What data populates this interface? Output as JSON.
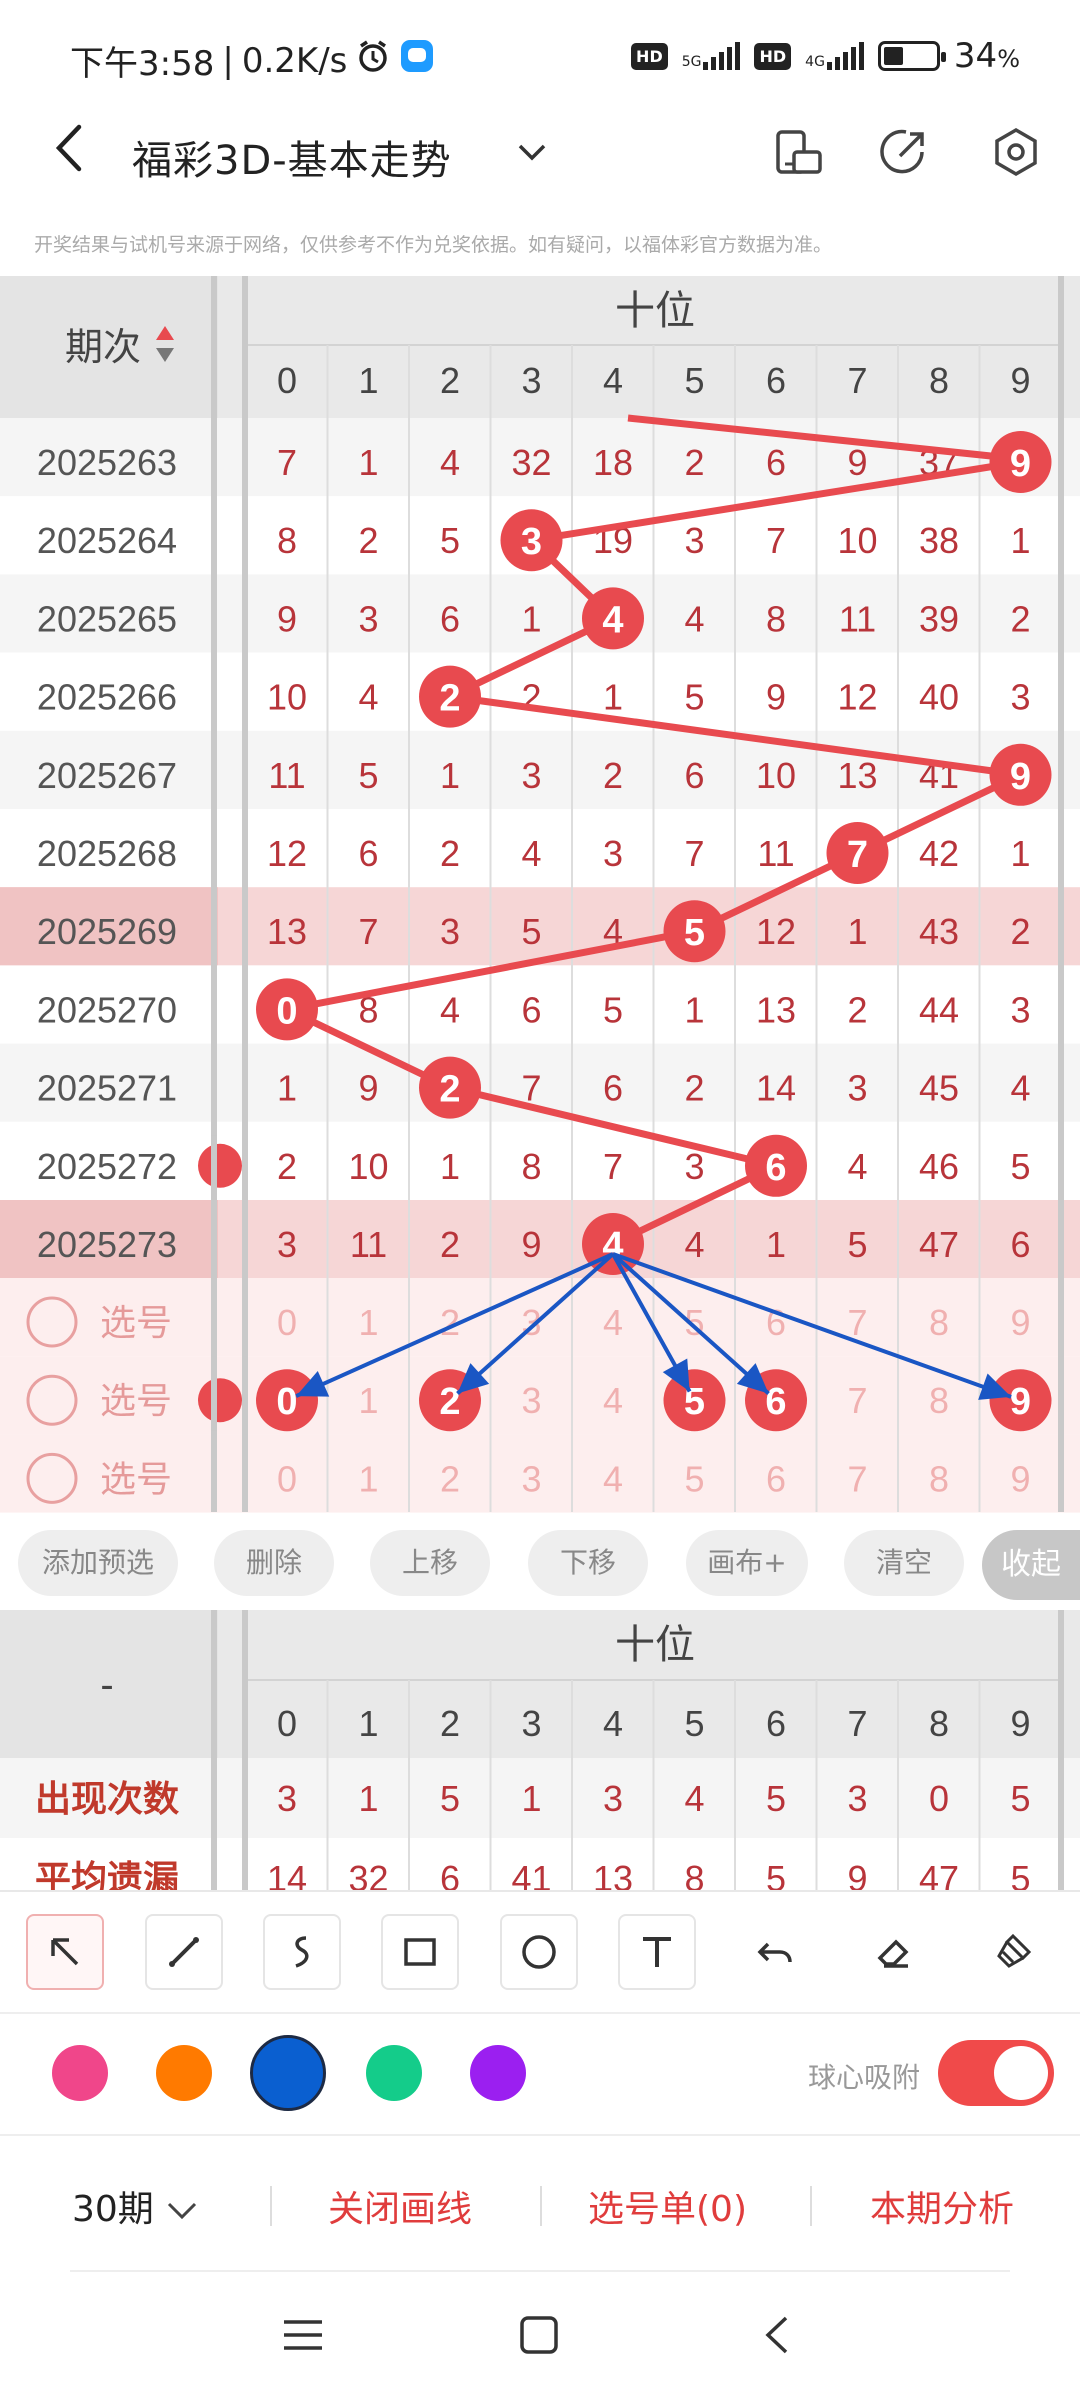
{
  "status_bar": {
    "time": "下午3:58",
    "speed": "0.2K/s",
    "net1": "5G",
    "net2": "4G",
    "hd": "HD",
    "battery": "34",
    "battery_unit": "%"
  },
  "header": {
    "title": "福彩3D-基本走势"
  },
  "disclaimer": "开奖结果与试机号来源于网络，仅供参考不作为兑奖依据。如有疑问，以福体彩官方数据为准。",
  "table": {
    "period_header": "期次",
    "position_header": "十位",
    "digits": [
      "0",
      "1",
      "2",
      "3",
      "4",
      "5",
      "6",
      "7",
      "8",
      "9"
    ],
    "rows": [
      {
        "period": "2025263",
        "cells": [
          "7",
          "1",
          "4",
          "32",
          "18",
          "2",
          "6",
          "9",
          "37",
          "9"
        ],
        "hit": 9
      },
      {
        "period": "2025264",
        "cells": [
          "8",
          "2",
          "5",
          "3",
          "19",
          "3",
          "7",
          "10",
          "38",
          "1"
        ],
        "hit": 3
      },
      {
        "period": "2025265",
        "cells": [
          "9",
          "3",
          "6",
          "1",
          "4",
          "4",
          "8",
          "11",
          "39",
          "2"
        ],
        "hit": 4
      },
      {
        "period": "2025266",
        "cells": [
          "10",
          "4",
          "2",
          "2",
          "1",
          "5",
          "9",
          "12",
          "40",
          "3"
        ],
        "hit": 2
      },
      {
        "period": "2025267",
        "cells": [
          "11",
          "5",
          "1",
          "3",
          "2",
          "6",
          "10",
          "13",
          "41",
          "9"
        ],
        "hit": 9
      },
      {
        "period": "2025268",
        "cells": [
          "12",
          "6",
          "2",
          "4",
          "3",
          "7",
          "11",
          "7",
          "42",
          "1"
        ],
        "hit": 7
      },
      {
        "period": "2025269",
        "cells": [
          "13",
          "7",
          "3",
          "5",
          "4",
          "5",
          "12",
          "1",
          "43",
          "2"
        ],
        "hit": 5
      },
      {
        "period": "2025270",
        "cells": [
          "0",
          "8",
          "4",
          "6",
          "5",
          "1",
          "13",
          "2",
          "44",
          "3"
        ],
        "hit": 0
      },
      {
        "period": "2025271",
        "cells": [
          "1",
          "9",
          "2",
          "7",
          "6",
          "2",
          "14",
          "3",
          "45",
          "4"
        ],
        "hit": 2
      },
      {
        "period": "2025272",
        "cells": [
          "2",
          "10",
          "1",
          "8",
          "7",
          "3",
          "6",
          "4",
          "46",
          "5"
        ],
        "hit": 6
      },
      {
        "period": "2025273",
        "cells": [
          "3",
          "11",
          "2",
          "9",
          "4",
          "4",
          "1",
          "5",
          "47",
          "6"
        ],
        "hit": 4
      }
    ],
    "select_label": "选号",
    "select_rows": [
      {
        "cells": [
          "0",
          "1",
          "2",
          "3",
          "4",
          "5",
          "6",
          "7",
          "8",
          "9"
        ],
        "selected": []
      },
      {
        "cells": [
          "0",
          "1",
          "2",
          "3",
          "4",
          "5",
          "6",
          "7",
          "8",
          "9"
        ],
        "selected": [
          0,
          2,
          5,
          6,
          9
        ]
      },
      {
        "cells": [
          "0",
          "1",
          "2",
          "3",
          "4",
          "5",
          "6",
          "7",
          "8",
          "9"
        ],
        "selected": []
      }
    ]
  },
  "actions": [
    "添加预选",
    "删除",
    "上移",
    "下移",
    "画布+",
    "清空"
  ],
  "collapse_label": "收起",
  "stats": {
    "dash": "-",
    "position_header": "十位",
    "rows": [
      {
        "label": "出现次数",
        "values": [
          "3",
          "1",
          "5",
          "1",
          "3",
          "4",
          "5",
          "3",
          "0",
          "5"
        ]
      },
      {
        "label": "平均遗漏",
        "values": [
          "14",
          "32",
          "6",
          "41",
          "13",
          "8",
          "5",
          "9",
          "47",
          "5"
        ]
      }
    ]
  },
  "draw_tools": [
    "select-arrow-icon",
    "line-icon",
    "curve-icon",
    "rectangle-icon",
    "circle-icon",
    "text-icon",
    "undo-icon",
    "eraser-icon",
    "clear-brush-icon"
  ],
  "colors": [
    "#f0468a",
    "#ff7a00",
    "#0a5fd0",
    "#14cc8a",
    "#9b1ff0"
  ],
  "selected_color": "#0a5fd0",
  "snap_label": "球心吸附",
  "snap_on": true,
  "bottom": {
    "periods": "30期",
    "close_lines": "关闭画线",
    "ticket": "选号单(0)",
    "analysis": "本期分析"
  },
  "accent": "#e84a4f"
}
